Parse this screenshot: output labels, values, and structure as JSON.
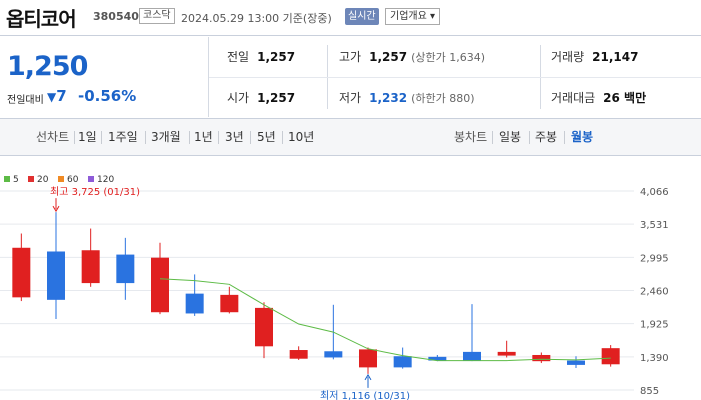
{
  "header": {
    "name": "옵티코어",
    "code": "380540",
    "market": "코스닥",
    "timestamp": "2024.05.29 13:00  기준(장중)",
    "realtime": "실시간",
    "company_overview": "기업개요 ▾"
  },
  "price": {
    "current": "1,250",
    "change_label": "전일대비",
    "change_arrow": "▼",
    "change": "7",
    "change_pct": "-0.56%"
  },
  "quote": {
    "prev_close": {
      "label": "전일",
      "value": "1,257"
    },
    "high": {
      "label": "고가",
      "value": "1,257",
      "sub": "(상한가 1,634)"
    },
    "volume": {
      "label": "거래량",
      "value": "21,147"
    },
    "open": {
      "label": "시가",
      "value": "1,257"
    },
    "low": {
      "label": "저가",
      "value": "1,232",
      "sub": "(하한가 880)"
    },
    "amount": {
      "label": "거래대금",
      "value": "26 백만"
    }
  },
  "toolbar": {
    "line_chart": "선차트",
    "line_periods": [
      "1일",
      "1주일",
      "3개월",
      "1년",
      "3년",
      "5년",
      "10년"
    ],
    "candle_chart": "봉차트",
    "candle_periods": [
      "일봉",
      "주봉",
      "월봉"
    ],
    "active_candle": "월봉"
  },
  "colors": {
    "up": "#e02020",
    "down": "#2a73e0",
    "ma5": "#5dbb46",
    "ma20": "#e03030",
    "ma60": "#f08a24",
    "ma120": "#8e5bd8",
    "accent": "#1b63c8"
  },
  "chart_data": {
    "type": "candlestick",
    "legend": [
      "5",
      "20",
      "60",
      "120"
    ],
    "y_ticks": [
      4066,
      3531,
      2995,
      2460,
      1925,
      1390,
      855
    ],
    "y_tick_labels": [
      "4,066",
      "3,531",
      "2,995",
      "2,460",
      "1,925",
      "1,390",
      "855"
    ],
    "ylim": [
      855,
      4066
    ],
    "candles": [
      {
        "open": 2350,
        "close": 3150,
        "high": 3380,
        "low": 2290
      },
      {
        "open": 3090,
        "close": 2310,
        "high": 3725,
        "low": 2000
      },
      {
        "open": 2580,
        "close": 3110,
        "high": 3460,
        "low": 2520
      },
      {
        "open": 3040,
        "close": 2580,
        "high": 3310,
        "low": 2310
      },
      {
        "open": 2110,
        "close": 2990,
        "high": 3230,
        "low": 2080
      },
      {
        "open": 2410,
        "close": 2090,
        "high": 2720,
        "low": 2050
      },
      {
        "open": 2110,
        "close": 2390,
        "high": 2520,
        "low": 2090
      },
      {
        "open": 1560,
        "close": 2180,
        "high": 2270,
        "low": 1370
      },
      {
        "open": 1360,
        "close": 1500,
        "high": 1560,
        "low": 1340
      },
      {
        "open": 1480,
        "close": 1380,
        "high": 2230,
        "low": 1350
      },
      {
        "open": 1220,
        "close": 1510,
        "high": 1540,
        "low": 1116
      },
      {
        "open": 1400,
        "close": 1220,
        "high": 1540,
        "low": 1200
      },
      {
        "open": 1390,
        "close": 1330,
        "high": 1420,
        "low": 1320
      },
      {
        "open": 1470,
        "close": 1330,
        "high": 2240,
        "low": 1320
      },
      {
        "open": 1410,
        "close": 1470,
        "high": 1650,
        "low": 1380
      },
      {
        "open": 1320,
        "close": 1420,
        "high": 1460,
        "low": 1290
      },
      {
        "open": 1330,
        "close": 1260,
        "high": 1400,
        "low": 1210
      },
      {
        "open": 1270,
        "close": 1530,
        "high": 1580,
        "low": 1232
      }
    ],
    "ma5": [
      null,
      null,
      null,
      null,
      2650,
      2620,
      2560,
      2230,
      1920,
      1790,
      1520,
      1410,
      1330,
      1330,
      1330,
      1350,
      1340,
      1370
    ],
    "annotations": {
      "high": "최고 3,725 (01/31)",
      "low": "최저 1,116 (10/31)"
    }
  }
}
